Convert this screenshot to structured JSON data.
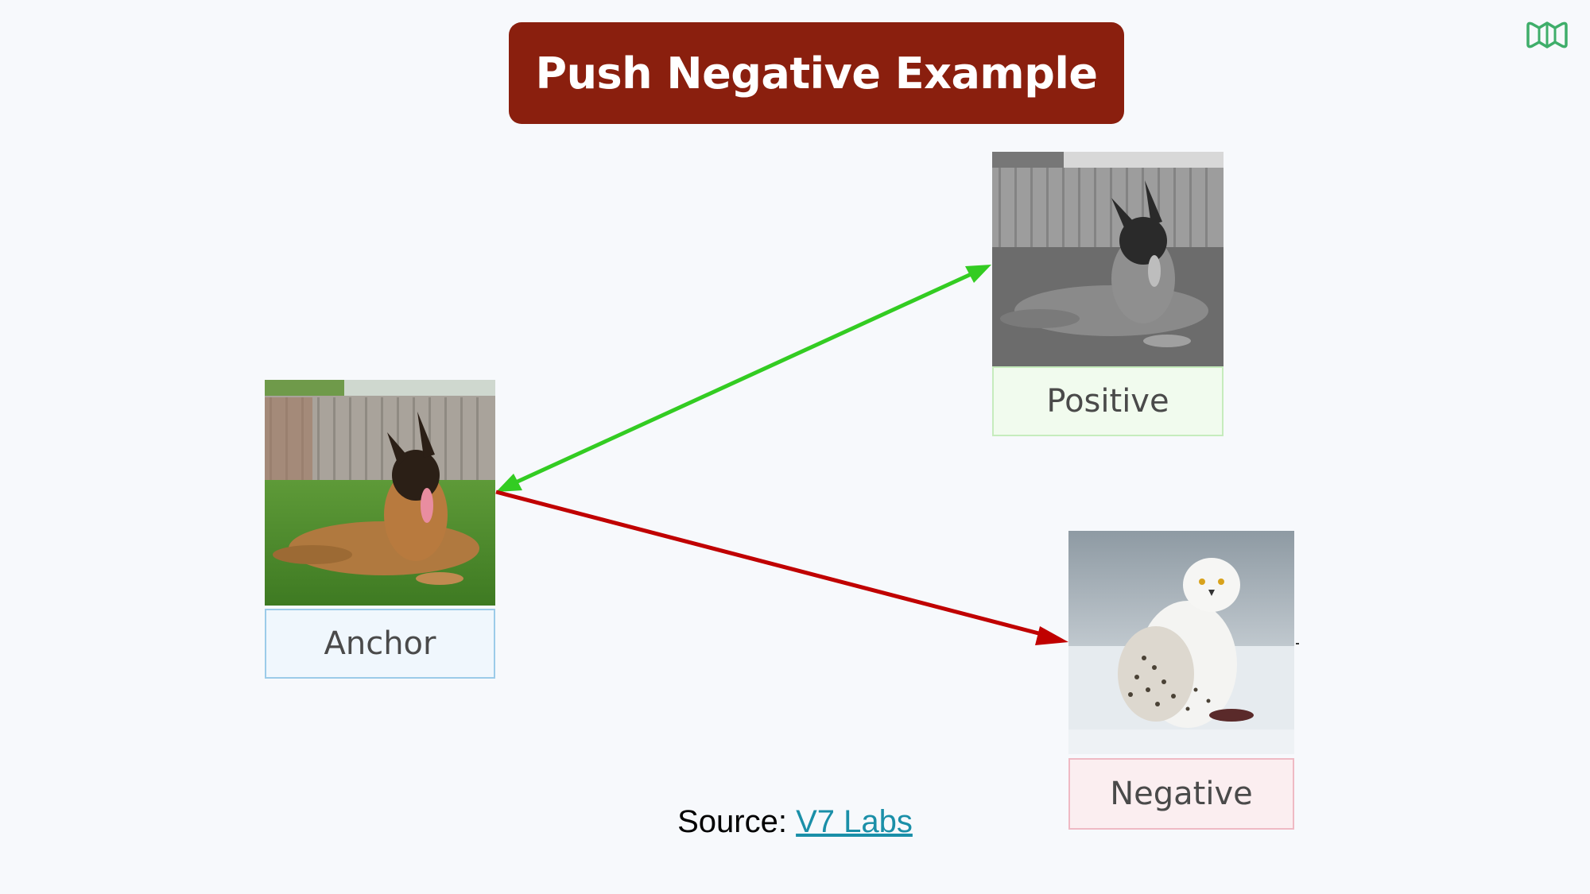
{
  "title": "Push Negative Example",
  "nodes": {
    "anchor": {
      "label": "Anchor"
    },
    "positive": {
      "label": "Positive"
    },
    "negative": {
      "label": "Negative"
    }
  },
  "edges": [
    {
      "from": "anchor",
      "to": "positive",
      "color": "#33cc22",
      "style": "double-arrow"
    },
    {
      "from": "anchor",
      "to": "negative",
      "color": "#c00000",
      "style": "single-arrow"
    }
  ],
  "source": {
    "prefix": "Source: ",
    "link_text": "V7 Labs"
  },
  "colors": {
    "banner": "#8a1f0e",
    "positive_arrow": "#33cc22",
    "negative_arrow": "#c00000",
    "link": "#1a8fa8"
  },
  "icons": {
    "logo": "brand-logo-icon"
  }
}
